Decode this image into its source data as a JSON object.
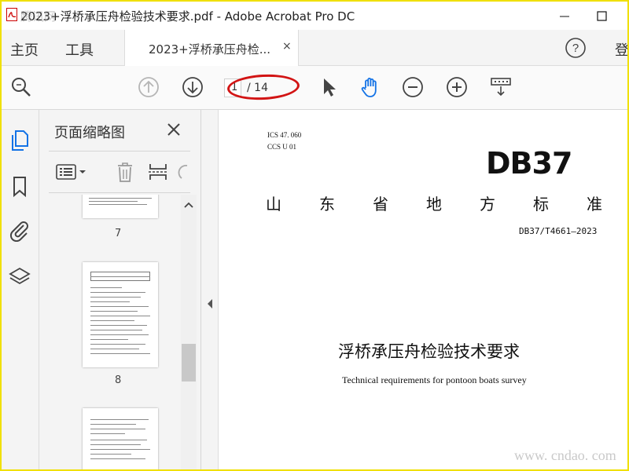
{
  "window": {
    "title": "2023+浮桥承压舟检验技术要求.pdf - Adobe Acrobat Pro DC",
    "watermark": "腾讯网"
  },
  "tabs": {
    "home_label": "主页",
    "tools_label": "工具",
    "doc_tab_label": "2023+浮桥承压舟检...",
    "close_glyph": "×",
    "login_label": "登"
  },
  "toolbar": {
    "current_page": "1",
    "total_pages": "/ 14",
    "annotation_color": "#d21414"
  },
  "thumbnails": {
    "title": "页面缩略图",
    "pages": [
      {
        "number": "7"
      },
      {
        "number": "8"
      }
    ]
  },
  "document": {
    "ics": "ICS  47. 060",
    "ccs": "CCS  U  01",
    "logo_text": "DB37",
    "province_chars": [
      "山",
      "东",
      "省",
      "地",
      "方",
      "标",
      "准"
    ],
    "standard_code": "DB37/T4661—2023",
    "title_cn": "浮桥承压舟检验技术要求",
    "title_en": "Technical requirements for pontoon boats survey"
  },
  "watermark_site": "www. cndao. com",
  "colors": {
    "frame_border": "#f0e000",
    "accent_blue": "#1473e6"
  }
}
